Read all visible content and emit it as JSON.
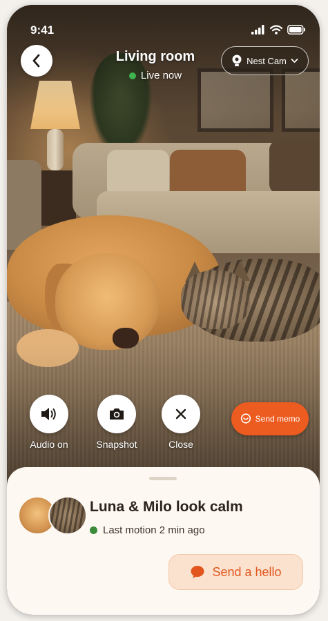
{
  "status_bar": {
    "time": "9:41"
  },
  "header": {
    "title": "Living room",
    "live_label": "Live now",
    "camera_name": "Nest Cam"
  },
  "controls": {
    "audio_label": "Audio on",
    "snapshot_label": "Snapshot",
    "close_label": "Close",
    "memo_label": "Send memo"
  },
  "sheet": {
    "title": "Luna & Milo look calm",
    "motion_text": "Last motion 2 min ago",
    "hello_label": "Send a hello"
  },
  "colors": {
    "accent": "#ec5b1f",
    "live": "#3fb34f",
    "motion": "#3a8c3a",
    "sheet_bg": "#fdf8f2",
    "hello_bg": "#fbe2cf"
  },
  "icons": [
    "back-chevron-icon",
    "camera-pin-icon",
    "chevron-down-icon",
    "speaker-icon",
    "camera-icon",
    "close-icon",
    "memo-icon",
    "chat-bubble-icon",
    "signal-icon",
    "wifi-icon",
    "battery-icon"
  ]
}
